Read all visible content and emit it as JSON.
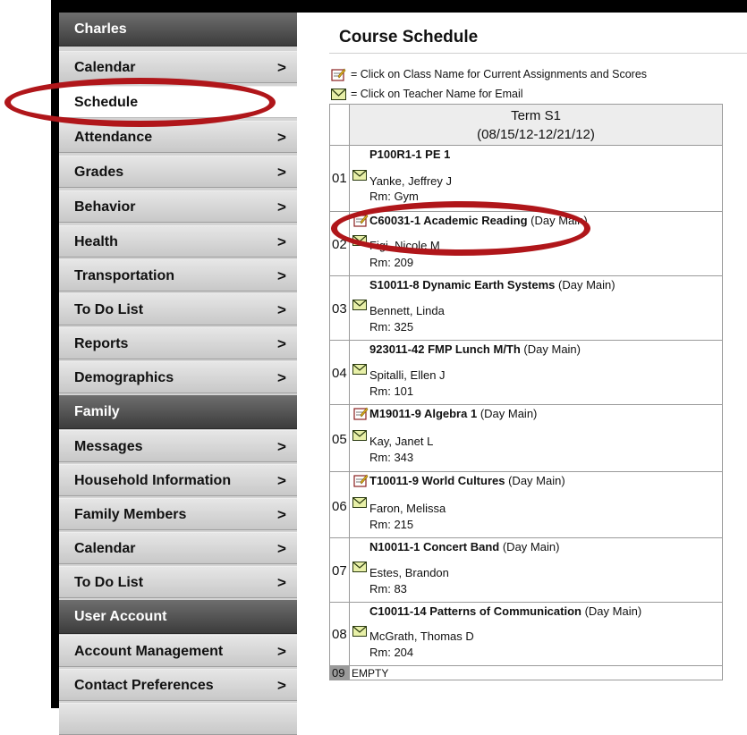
{
  "sidebar": {
    "student_header": "Charles",
    "student_items": [
      {
        "label": "Calendar",
        "chevron": ">"
      },
      {
        "label": "Schedule",
        "chevron": ""
      },
      {
        "label": "Attendance",
        "chevron": ">"
      },
      {
        "label": "Grades",
        "chevron": ">"
      },
      {
        "label": "Behavior",
        "chevron": ">"
      },
      {
        "label": "Health",
        "chevron": ">"
      },
      {
        "label": "Transportation",
        "chevron": ">"
      },
      {
        "label": "To Do List",
        "chevron": ">"
      },
      {
        "label": "Reports",
        "chevron": ">"
      },
      {
        "label": "Demographics",
        "chevron": ">"
      }
    ],
    "family_header": "Family",
    "family_items": [
      {
        "label": "Messages",
        "chevron": ">"
      },
      {
        "label": "Household Information",
        "chevron": ">"
      },
      {
        "label": "Family Members",
        "chevron": ">"
      },
      {
        "label": "Calendar",
        "chevron": ">"
      },
      {
        "label": "To Do List",
        "chevron": ">"
      }
    ],
    "account_header": "User Account",
    "account_items": [
      {
        "label": "Account Management",
        "chevron": ">"
      },
      {
        "label": "Contact Preferences",
        "chevron": ">"
      }
    ]
  },
  "main": {
    "title": "Course Schedule",
    "legend": {
      "assignments": "= Click on Class Name for Current Assignments and Scores",
      "email": "= Click on Teacher Name for Email"
    },
    "term": {
      "name": "Term S1",
      "dates": "(08/15/12-12/21/12)"
    },
    "periods": [
      {
        "num": "01",
        "class": "P100R1-1 PE 1",
        "section": "",
        "teacher": "Yanke, Jeffrey J",
        "room": "Rm: Gym"
      },
      {
        "num": "02",
        "class": "C60031-1 Academic Reading",
        "section": " (Day Main)",
        "teacher": "Figi, Nicole M",
        "room": "Rm: 209"
      },
      {
        "num": "03",
        "class": "S10011-8 Dynamic Earth Systems",
        "section": " (Day Main)",
        "teacher": "Bennett, Linda",
        "room": "Rm: 325"
      },
      {
        "num": "04",
        "class": "923011-42 FMP Lunch M/Th",
        "section": " (Day Main)",
        "teacher": "Spitalli, Ellen J",
        "room": "Rm: 101"
      },
      {
        "num": "05",
        "class": "M19011-9 Algebra 1",
        "section": " (Day Main)",
        "teacher": "Kay, Janet L",
        "room": "Rm: 343"
      },
      {
        "num": "06",
        "class": "T10011-9 World Cultures",
        "section": " (Day Main)",
        "teacher": "Faron, Melissa",
        "room": "Rm: 215"
      },
      {
        "num": "07",
        "class": "N10011-1 Concert Band",
        "section": " (Day Main)",
        "teacher": "Estes, Brandon",
        "room": "Rm: 83"
      },
      {
        "num": "08",
        "class": "C10011-14 Patterns of Communication",
        "section": " (Day Main)",
        "teacher": "McGrath, Thomas D",
        "room": "Rm: 204"
      },
      {
        "num": "09",
        "class": "EMPTY"
      }
    ]
  },
  "icons": {
    "assignment": "assignment-icon",
    "email": "envelope-icon"
  },
  "colors": {
    "highlight": "#b0161a",
    "header_dark": "#4a4a4a"
  }
}
